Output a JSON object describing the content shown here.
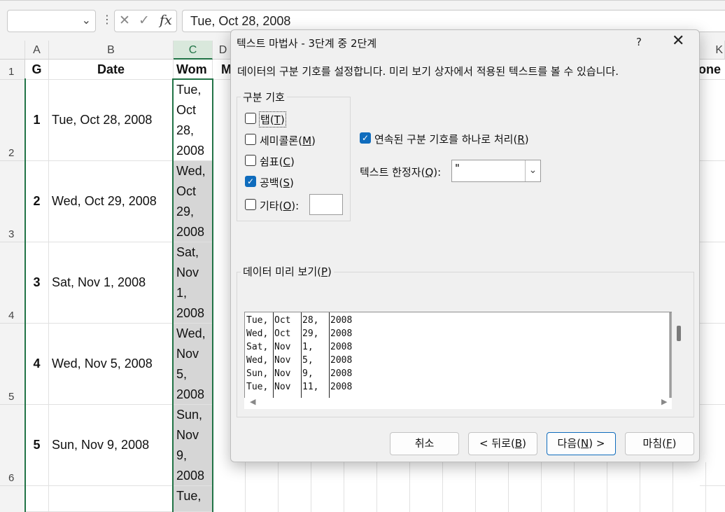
{
  "formula_bar": {
    "formula": "Tue, Oct 28, 2008",
    "cancel_glyph": "✕",
    "enter_glyph": "✓",
    "fx_label": "fx"
  },
  "columns": [
    "A",
    "B",
    "C",
    "D",
    "K"
  ],
  "rows": [
    "1",
    "2",
    "3",
    "4",
    "5",
    "6"
  ],
  "header_row": {
    "a": "G",
    "b": "Date",
    "c": "Wom",
    "d": "M",
    "k": "one"
  },
  "data_rows": [
    {
      "num": "1",
      "date": "Tue, Oct 28, 2008",
      "wrap": "Tue,\nOct\n28,\n2008"
    },
    {
      "num": "2",
      "date": "Wed, Oct 29, 2008",
      "wrap": "Wed,\nOct\n29,\n2008"
    },
    {
      "num": "3",
      "date": "Sat, Nov 1, 2008",
      "wrap": "Sat,\nNov\n1,\n2008"
    },
    {
      "num": "4",
      "date": "Wed, Nov 5, 2008",
      "wrap": "Wed,\nNov\n5,\n2008"
    },
    {
      "num": "5",
      "date": "Sun, Nov 9, 2008",
      "wrap": "Sun,\nNov\n9,\n2008"
    }
  ],
  "partial_cell": "Tue,",
  "dialog": {
    "title": "텍스트 마법사 - 3단계 중 2단계",
    "help": "?",
    "close": "✕",
    "instruction": "데이터의 구분 기호를 설정합니다. 미리 보기 상자에서 적용된 텍스트를 볼 수 있습니다.",
    "delimiters_group": "구분 기호",
    "delimiters": [
      {
        "label": "탭",
        "key": "T",
        "checked": false
      },
      {
        "label": "세미콜론",
        "key": "M",
        "checked": false
      },
      {
        "label": "쉼표",
        "key": "C",
        "checked": false
      },
      {
        "label": "공백",
        "key": "S",
        "checked": true
      },
      {
        "label": "기타",
        "key": "O",
        "checked": false,
        "suffix": ":"
      }
    ],
    "consecutive": {
      "label": "연속된 구분 기호를 하나로 처리",
      "key": "R",
      "checked": true
    },
    "qualifier": {
      "label": "텍스트 한정자",
      "key": "Q",
      "suffix": ":",
      "value": "\""
    },
    "preview_group": "데이터 미리 보기",
    "preview_key": "P",
    "preview_rows": [
      [
        "Tue,",
        "Oct",
        "28,",
        "2008"
      ],
      [
        "Wed,",
        "Oct",
        "29,",
        "2008"
      ],
      [
        "Sat,",
        "Nov",
        "1,",
        "2008"
      ],
      [
        "Wed,",
        "Nov",
        "5,",
        "2008"
      ],
      [
        "Sun,",
        "Nov",
        "9,",
        "2008"
      ],
      [
        "Tue,",
        "Nov",
        "11,",
        "2008"
      ]
    ],
    "buttons": {
      "cancel": "취소",
      "back": "< 뒤로(B)",
      "next": "다음(N) >",
      "finish": "마침(F)"
    }
  },
  "colors": {
    "accent": "#0f6cbd",
    "excel_green": "#217346"
  }
}
